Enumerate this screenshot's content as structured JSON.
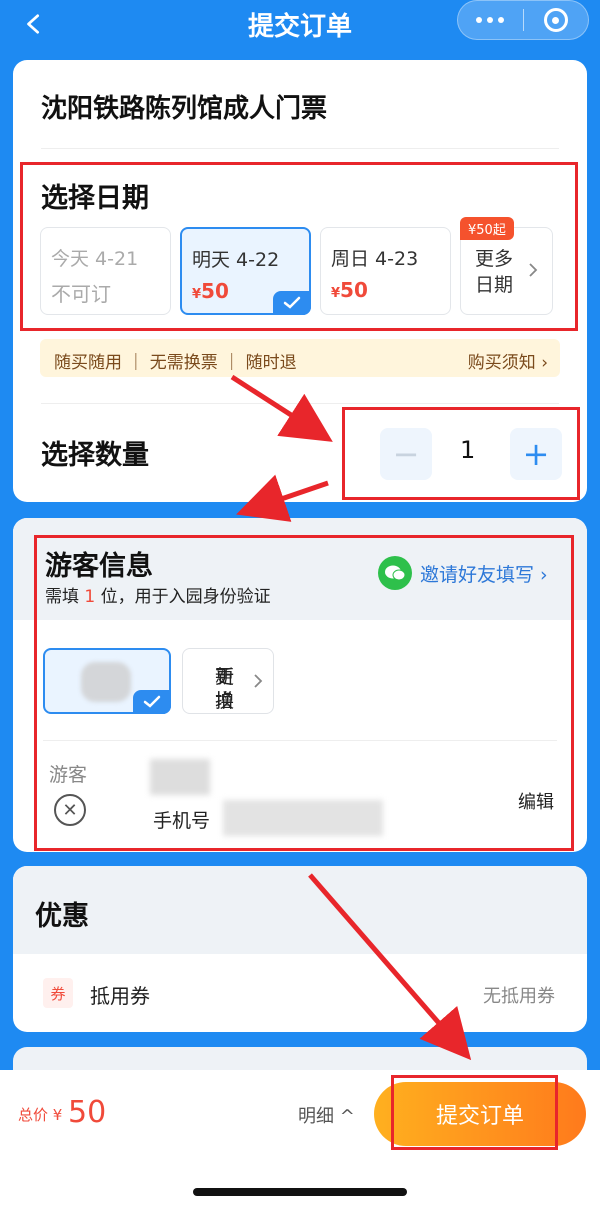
{
  "header": {
    "title": "提交订单",
    "back_icon": "chevron-left-icon",
    "more_icon": "more-dots-icon",
    "target_icon": "target-icon"
  },
  "product": {
    "name": "沈阳铁路陈列馆成人门票"
  },
  "date_section": {
    "title": "选择日期",
    "options": [
      {
        "label": "今天 4-21",
        "price": "不可订",
        "state": "disabled"
      },
      {
        "label": "明天 4-22",
        "price_symbol": "¥",
        "price": "50",
        "state": "selected"
      },
      {
        "label": "周日 4-23",
        "price_symbol": "¥",
        "price": "50",
        "state": "normal"
      }
    ],
    "more": {
      "line1": "更多",
      "line2": "日期",
      "badge": "¥50起"
    }
  },
  "notice": {
    "left": "随买随用 ｜ 无需换票 ｜ 随时退",
    "right": "购买须知 ›"
  },
  "quantity_section": {
    "title": "选择数量",
    "minus": "−",
    "plus": "+",
    "value": "1"
  },
  "visitor_section": {
    "title": "游客信息",
    "subtitle_pre": "需填 ",
    "subtitle_num": "1",
    "subtitle_post": " 位，用于入园身份验证",
    "invite": "邀请好友填写 ›",
    "new_line1": "新增",
    "new_line2": "更换",
    "visitor_label": "游客",
    "phone_label": "手机号",
    "edit": "编辑"
  },
  "discount_section": {
    "title": "优惠",
    "coupon_tag": "券",
    "coupon_label": "抵用券",
    "coupon_value": "无抵用券"
  },
  "bottom_bar": {
    "total_label": "总价 ¥",
    "total_value": "50",
    "detail": "明细 ^",
    "submit": "提交订单"
  },
  "colors": {
    "brand_blue": "#1e8af2",
    "price_red": "#f04a3a",
    "submit_orange": "#ff8a1c",
    "annotation_red": "#e8262b"
  }
}
